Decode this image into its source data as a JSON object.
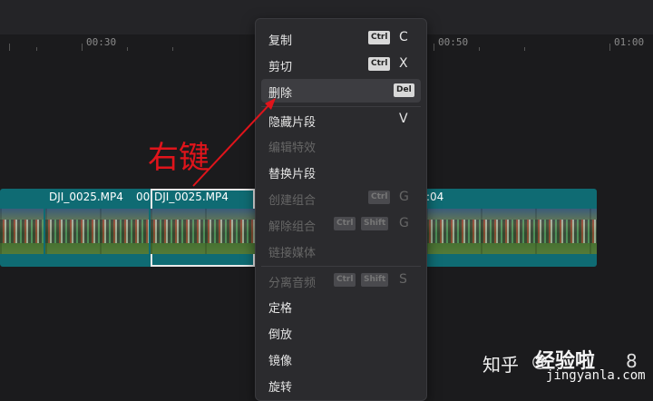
{
  "ruler": {
    "ticks": [
      "00:30",
      "00:50",
      "01:00"
    ]
  },
  "clips": [
    {
      "name": "DJI_0025.MP4"
    },
    {
      "name": "00"
    },
    {
      "name": "DJI_0025.MP4"
    },
    {
      "name": "00"
    },
    {
      "name": ":04"
    }
  ],
  "context_menu": {
    "items": [
      {
        "label": "复制",
        "kbd": [
          "Ctrl"
        ],
        "key": "C",
        "enabled": true
      },
      {
        "label": "剪切",
        "kbd": [
          "Ctrl"
        ],
        "key": "X",
        "enabled": true
      },
      {
        "label": "删除",
        "kbd": [
          "Del"
        ],
        "key": "",
        "enabled": true,
        "hovered": true
      },
      {
        "label": "隐藏片段",
        "kbd": [],
        "key": "V",
        "enabled": true
      },
      {
        "label": "编辑特效",
        "kbd": [],
        "key": "",
        "enabled": false
      },
      {
        "label": "替换片段",
        "kbd": [],
        "key": "",
        "enabled": true
      },
      {
        "label": "创建组合",
        "kbd": [
          "Ctrl"
        ],
        "key": "G",
        "enabled": false
      },
      {
        "label": "解除组合",
        "kbd": [
          "Ctrl",
          "Shift"
        ],
        "key": "G",
        "enabled": false
      },
      {
        "label": "链接媒体",
        "kbd": [],
        "key": "",
        "enabled": false
      },
      {
        "label": "分离音频",
        "kbd": [
          "Ctrl",
          "Shift"
        ],
        "key": "S",
        "enabled": false
      },
      {
        "label": "定格",
        "kbd": [],
        "key": "",
        "enabled": true
      },
      {
        "label": "倒放",
        "kbd": [],
        "key": "",
        "enabled": true
      },
      {
        "label": "镜像",
        "kbd": [],
        "key": "",
        "enabled": true
      },
      {
        "label": "旋转",
        "kbd": [],
        "key": "",
        "enabled": true
      }
    ]
  },
  "annotation": {
    "text": "右键",
    "color": "#e0141b"
  },
  "watermark": {
    "site": "知乎",
    "at": "@",
    "brand": "经验啦",
    "url": "jingyanla.com",
    "suffix": "8"
  },
  "colors": {
    "track": "#0f6b73",
    "menu_bg": "#2b2b2e",
    "annotation": "#e0141b"
  }
}
